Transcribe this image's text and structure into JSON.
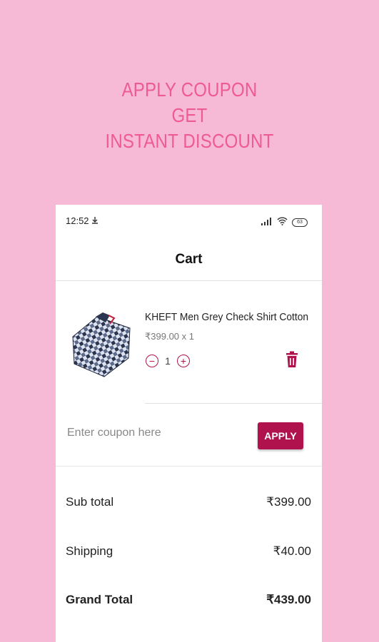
{
  "promo": {
    "line1": "APPLY COUPON",
    "line2": "GET",
    "line3": "INSTANT DISCOUNT"
  },
  "status_bar": {
    "time": "12:52",
    "battery": "63"
  },
  "appbar": {
    "title": "Cart"
  },
  "cart_item": {
    "name": "KHEFT Men Grey Check Shirt Cotton",
    "price_line": "₹399.00 x 1",
    "quantity": "1",
    "minus_symbol": "−",
    "plus_symbol": "+"
  },
  "coupon": {
    "placeholder": "Enter coupon here",
    "value": "",
    "apply_label": "APPLY"
  },
  "summary": {
    "subtotal_label": "Sub total",
    "subtotal_value": "₹399.00",
    "shipping_label": "Shipping",
    "shipping_value": "₹40.00",
    "grand_label": "Grand Total",
    "grand_value": "₹439.00"
  },
  "colors": {
    "background": "#f7bad6",
    "promo_text": "#ee5a98",
    "accent": "#b0124e"
  }
}
